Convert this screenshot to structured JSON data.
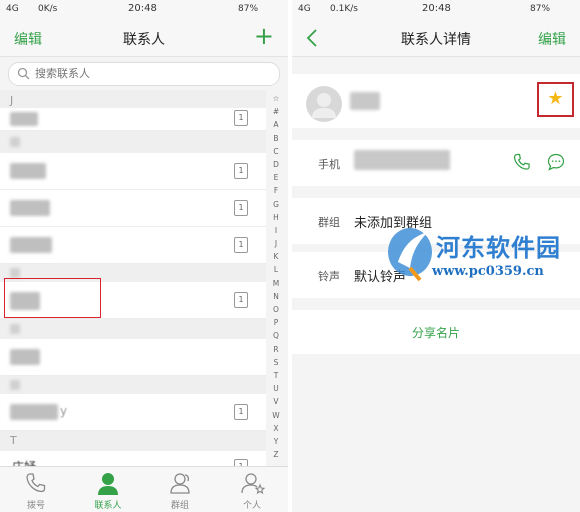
{
  "left": {
    "status": {
      "signal": "4G",
      "speed": "0K/s",
      "time": "20:48",
      "battery": "87%"
    },
    "nav": {
      "edit": "编辑",
      "title": "联系人",
      "add_icon": "plus-icon"
    },
    "search": {
      "placeholder": "搜索联系人"
    },
    "section_j": "J",
    "section_t": "T",
    "partial_name_suffix": "y",
    "last_visible_name": "庄妤",
    "sim_label": "1",
    "alphabet": [
      "☆",
      "#",
      "A",
      "B",
      "C",
      "D",
      "E",
      "F",
      "G",
      "H",
      "I",
      "J",
      "K",
      "L",
      "M",
      "N",
      "O",
      "P",
      "Q",
      "R",
      "S",
      "T",
      "U",
      "V",
      "W",
      "X",
      "Y",
      "Z"
    ],
    "tabs": [
      {
        "label": "拨号",
        "icon": "phone-icon"
      },
      {
        "label": "联系人",
        "icon": "contact-icon"
      },
      {
        "label": "群组",
        "icon": "group-icon"
      },
      {
        "label": "个人",
        "icon": "person-star-icon"
      }
    ]
  },
  "right": {
    "status": {
      "signal": "4G",
      "speed": "0.1K/s",
      "time": "20:48",
      "battery": "87%"
    },
    "nav": {
      "back_icon": "chevron-left-icon",
      "title": "联系人详情",
      "edit": "编辑"
    },
    "fields": {
      "phone_label": "手机",
      "group_label": "群组",
      "group_value": "未添加到群组",
      "ringtone_label": "铃声",
      "ringtone_value": "默认铃声"
    },
    "share": "分享名片"
  },
  "watermark": {
    "title": "河东软件园",
    "url": "www.pc0359.cn"
  },
  "colors": {
    "accent": "#35a24a",
    "highlight": "#d9232e",
    "star": "#f5b814"
  }
}
